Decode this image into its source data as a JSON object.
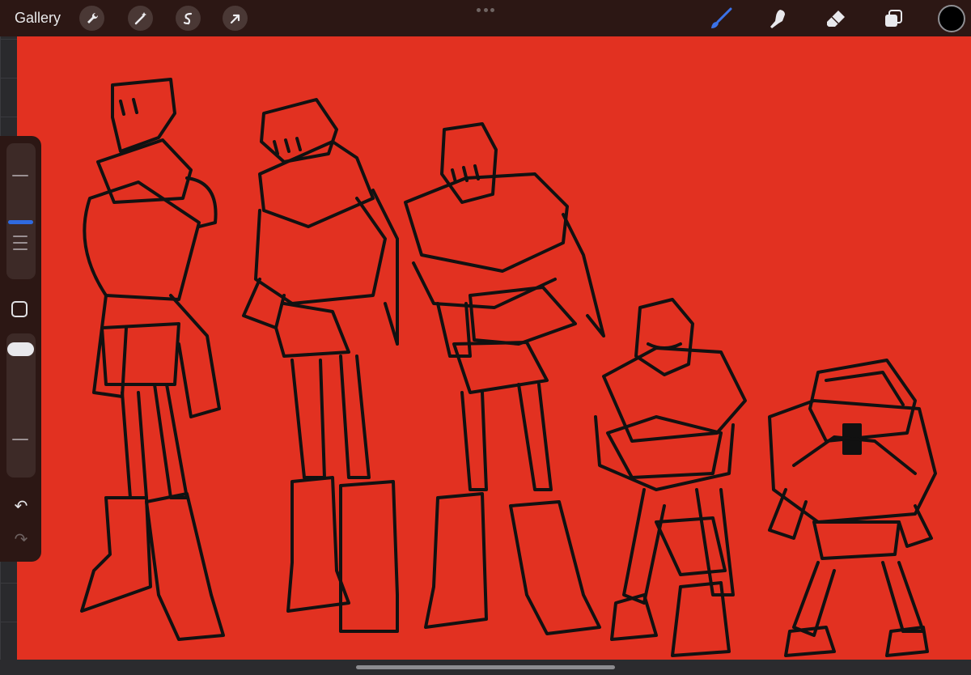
{
  "toolbar": {
    "gallery_label": "Gallery",
    "left_tools": [
      "wrench-icon",
      "magic-wand-icon",
      "selection-icon",
      "transform-arrow-icon"
    ],
    "right_tools": [
      "brush-icon",
      "smudge-icon",
      "eraser-icon",
      "layers-icon"
    ],
    "active_tool": "brush-icon",
    "accent_color": "#2f6ae0",
    "current_color": "#000000"
  },
  "sidebar": {
    "brush_size_level": 0.62,
    "opacity_level": 0.0,
    "icons": [
      "modify-square-icon",
      "undo-icon",
      "redo-icon"
    ]
  },
  "canvas": {
    "background_color": "#e23121",
    "ink_color": "#111111"
  }
}
